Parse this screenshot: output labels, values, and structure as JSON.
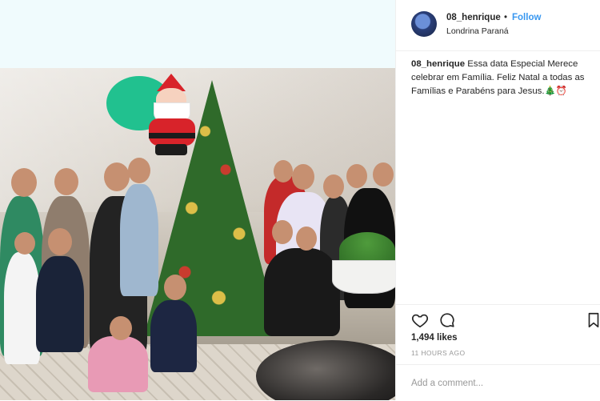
{
  "post": {
    "username": "08_henrique",
    "follow_label": "Follow",
    "separator": "•",
    "location": "Londrina Paraná",
    "caption_user": "08_henrique",
    "caption_text": "Essa data Especial Merece celebrar em Família. Feliz Natal a todas as Famílias e Parabéns para Jesus.🎄⏰",
    "likes": "1,494 likes",
    "time_ago": "11 HOURS AGO",
    "comment_placeholder": "Add a comment..."
  },
  "icons": {
    "like": "heart-icon",
    "comment": "comment-icon",
    "save": "bookmark-icon"
  },
  "colors": {
    "follow": "#3897f0",
    "sticker_bubble": "#21c18f",
    "santa_red": "#d8232a"
  }
}
